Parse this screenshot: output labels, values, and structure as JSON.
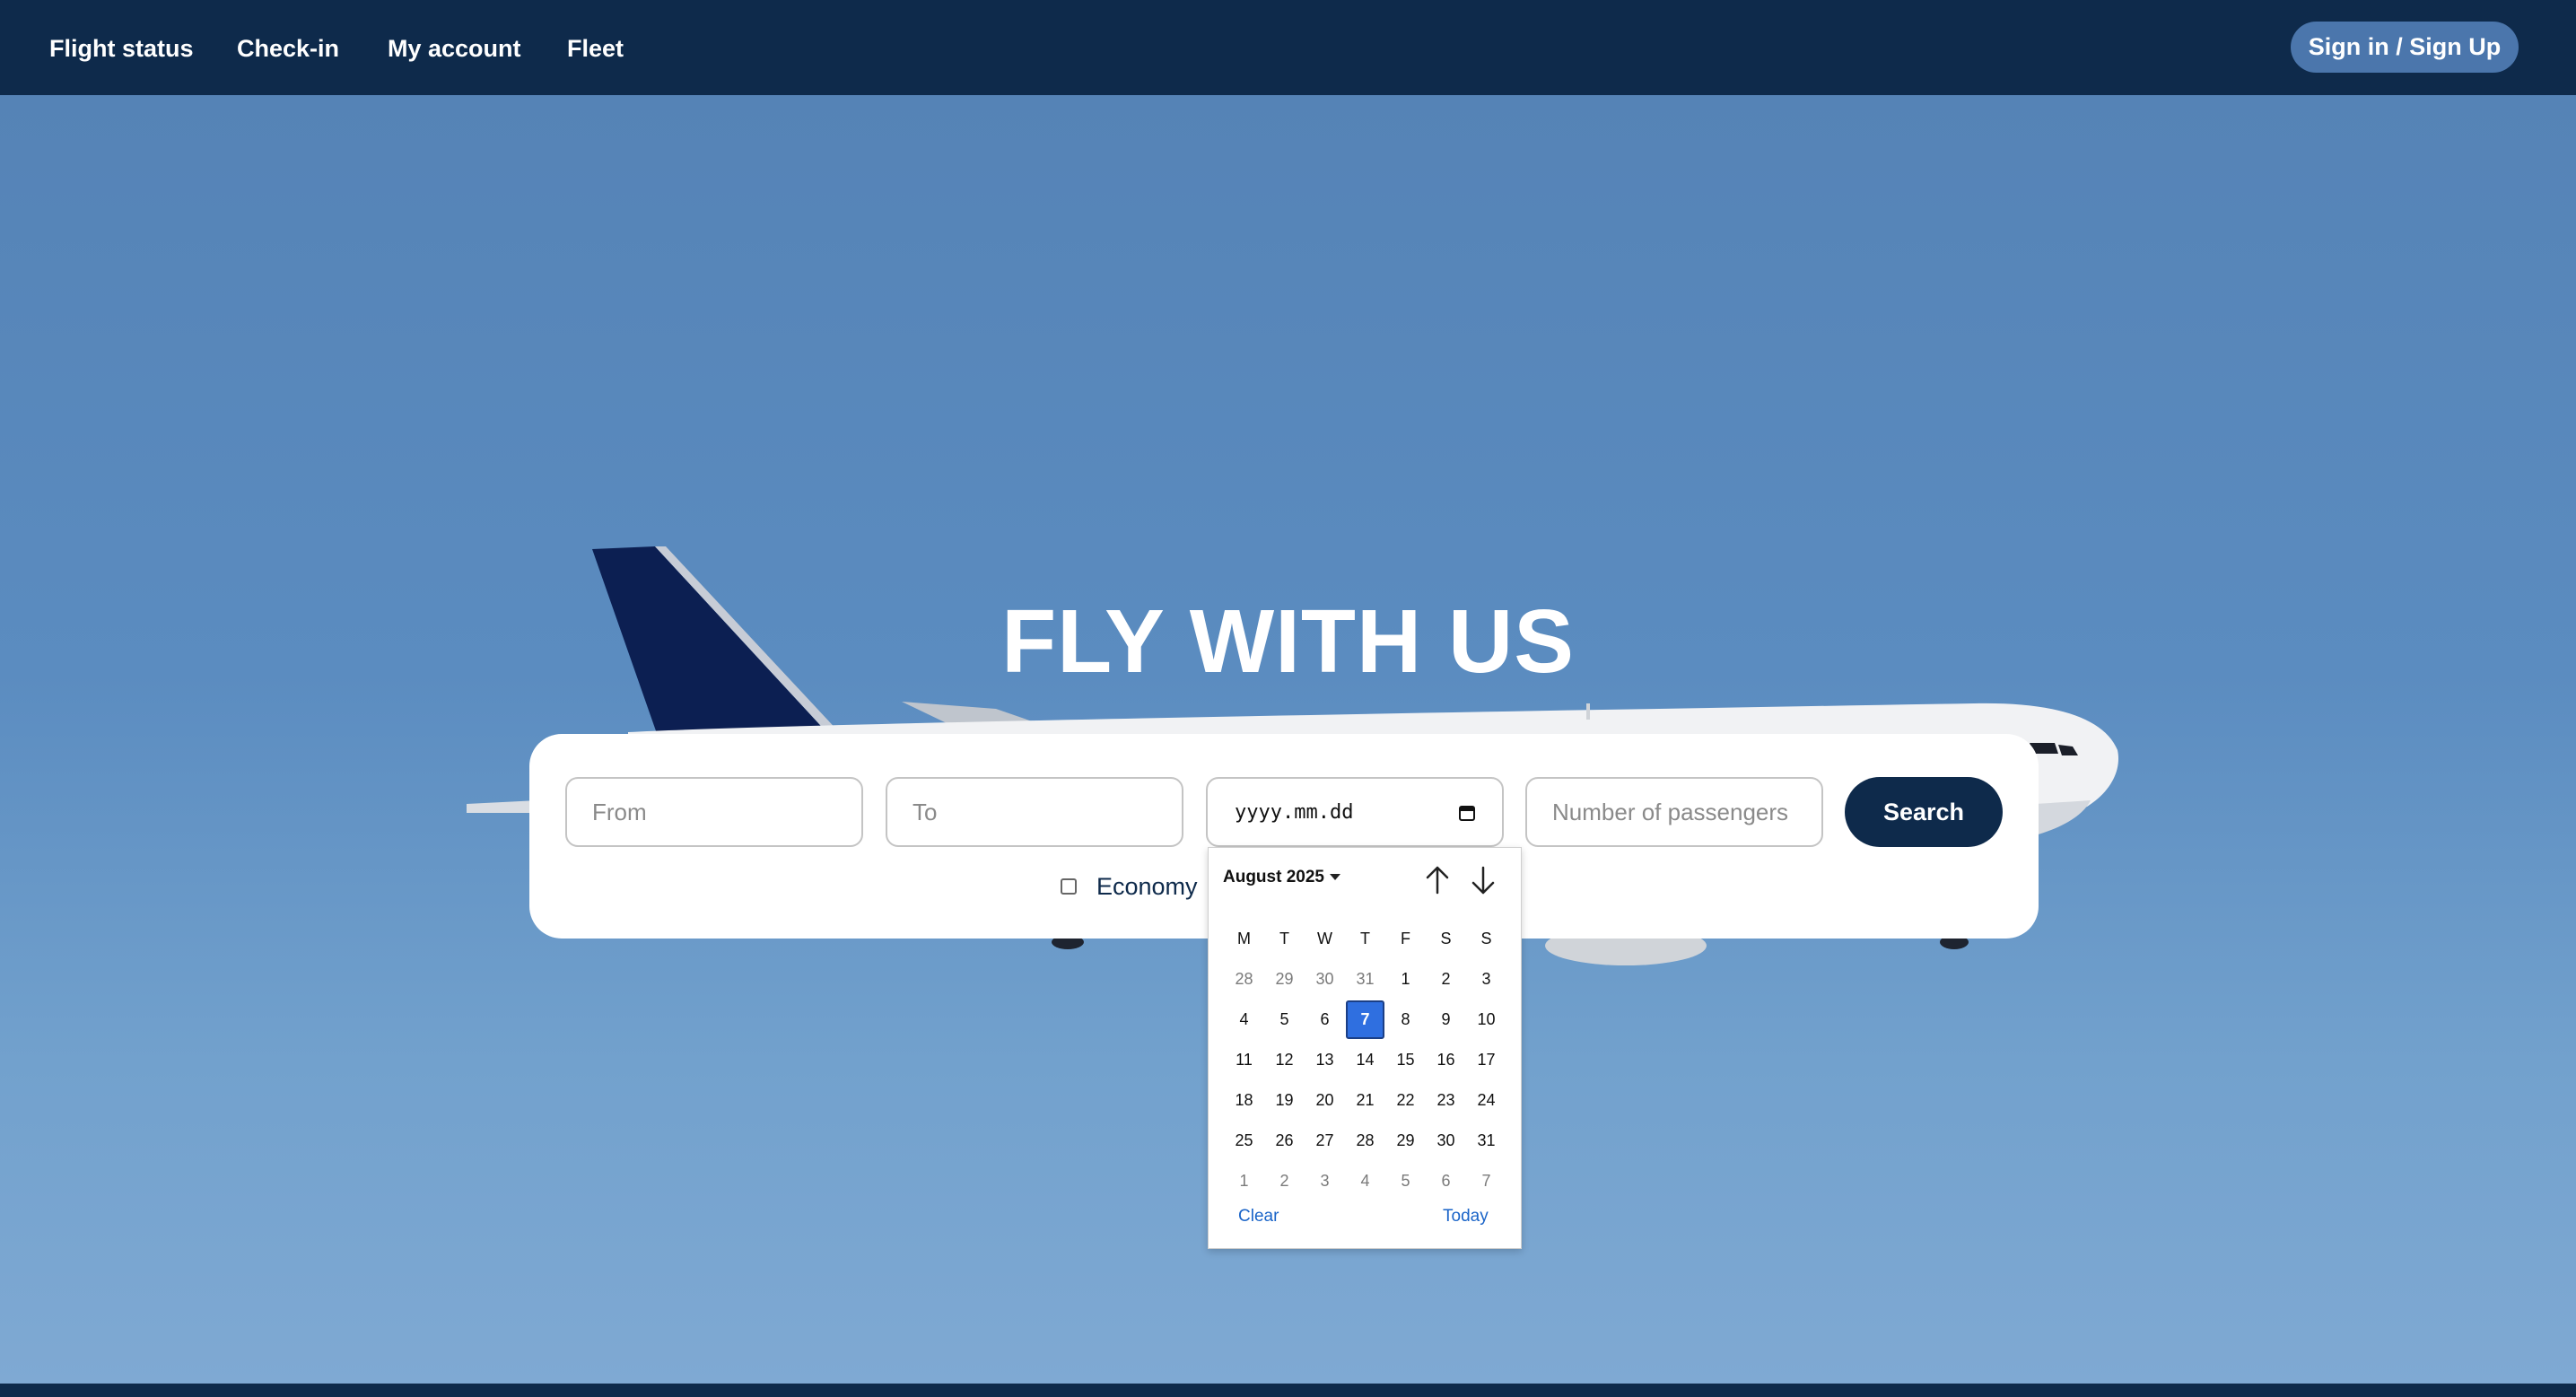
{
  "nav": {
    "links": [
      "Flight status",
      "Check-in",
      "My account",
      "Fleet"
    ],
    "signin_label": "Sign in / Sign Up"
  },
  "hero": {
    "title": "FLY WITH US"
  },
  "search": {
    "from_placeholder": "From",
    "to_placeholder": "To",
    "date_placeholder": "yyyy.mm.dd",
    "passengers_placeholder": "Number of passengers",
    "search_label": "Search",
    "economy_label": "Economy"
  },
  "calendar": {
    "month_label": "August 2025",
    "weekdays": [
      "M",
      "T",
      "W",
      "T",
      "F",
      "S",
      "S"
    ],
    "weeks": [
      [
        "28",
        "29",
        "30",
        "31",
        "1",
        "2",
        "3"
      ],
      [
        "4",
        "5",
        "6",
        "7",
        "8",
        "9",
        "10"
      ],
      [
        "11",
        "12",
        "13",
        "14",
        "15",
        "16",
        "17"
      ],
      [
        "18",
        "19",
        "20",
        "21",
        "22",
        "23",
        "24"
      ],
      [
        "25",
        "26",
        "27",
        "28",
        "29",
        "30",
        "31"
      ],
      [
        "1",
        "2",
        "3",
        "4",
        "5",
        "6",
        "7"
      ]
    ],
    "selected_day": "7",
    "clear_label": "Clear",
    "today_label": "Today"
  },
  "colors": {
    "navy": "#0e2a4b",
    "signin_bg": "#4b76ac",
    "selected_day": "#2f6fe0",
    "link_blue": "#1a64c8"
  }
}
